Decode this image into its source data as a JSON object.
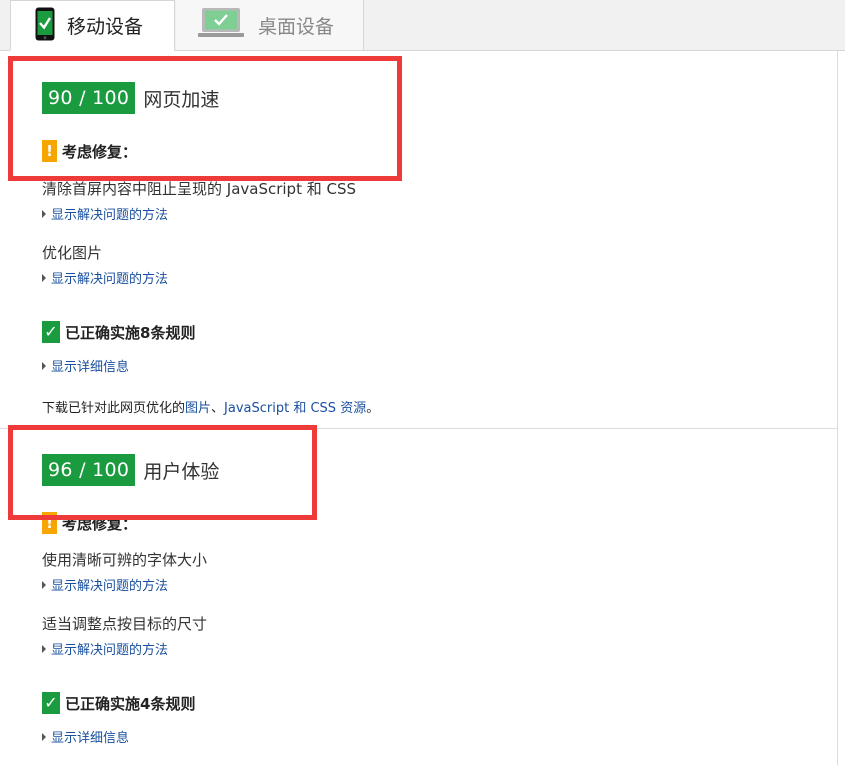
{
  "tabs": {
    "mobile_label": "移动设备",
    "desktop_label": "桌面设备"
  },
  "speed": {
    "score": "90 / 100",
    "title": "网页加速",
    "consider_label": "考虑修复：",
    "rules": [
      {
        "title": "清除首屏内容中阻止呈现的 JavaScript 和 CSS",
        "link": "显示解决问题的方法"
      },
      {
        "title": "优化图片",
        "link": "显示解决问题的方法"
      }
    ],
    "passed_label": "已正确实施8条规则",
    "details_link": "显示详细信息",
    "download": {
      "prefix": "下载已针对此网页优化的",
      "link_images": "图片",
      "sep": "、",
      "link_js_css": "JavaScript 和 CSS 资源",
      "suffix": "。"
    }
  },
  "ux": {
    "score": "96 / 100",
    "title": "用户体验",
    "consider_label": "考虑修复：",
    "rules": [
      {
        "title": "使用清晰可辨的字体大小",
        "link": "显示解决问题的方法"
      },
      {
        "title": "适当调整点按目标的尺寸",
        "link": "显示解决问题的方法"
      }
    ],
    "passed_label": "已正确实施4条规则",
    "details_link": "显示详细信息"
  },
  "colors": {
    "score_green": "#1a9b3f",
    "warning_orange": "#f7a600",
    "link_blue": "#1a4fa0",
    "highlight_red": "#ef3a3a"
  },
  "icons": {
    "mobile_tab": "smartphone-check-icon",
    "desktop_tab": "monitor-check-icon",
    "warning": "exclamation-icon",
    "passed": "checkmark-icon",
    "expand": "triangle-right-icon"
  }
}
